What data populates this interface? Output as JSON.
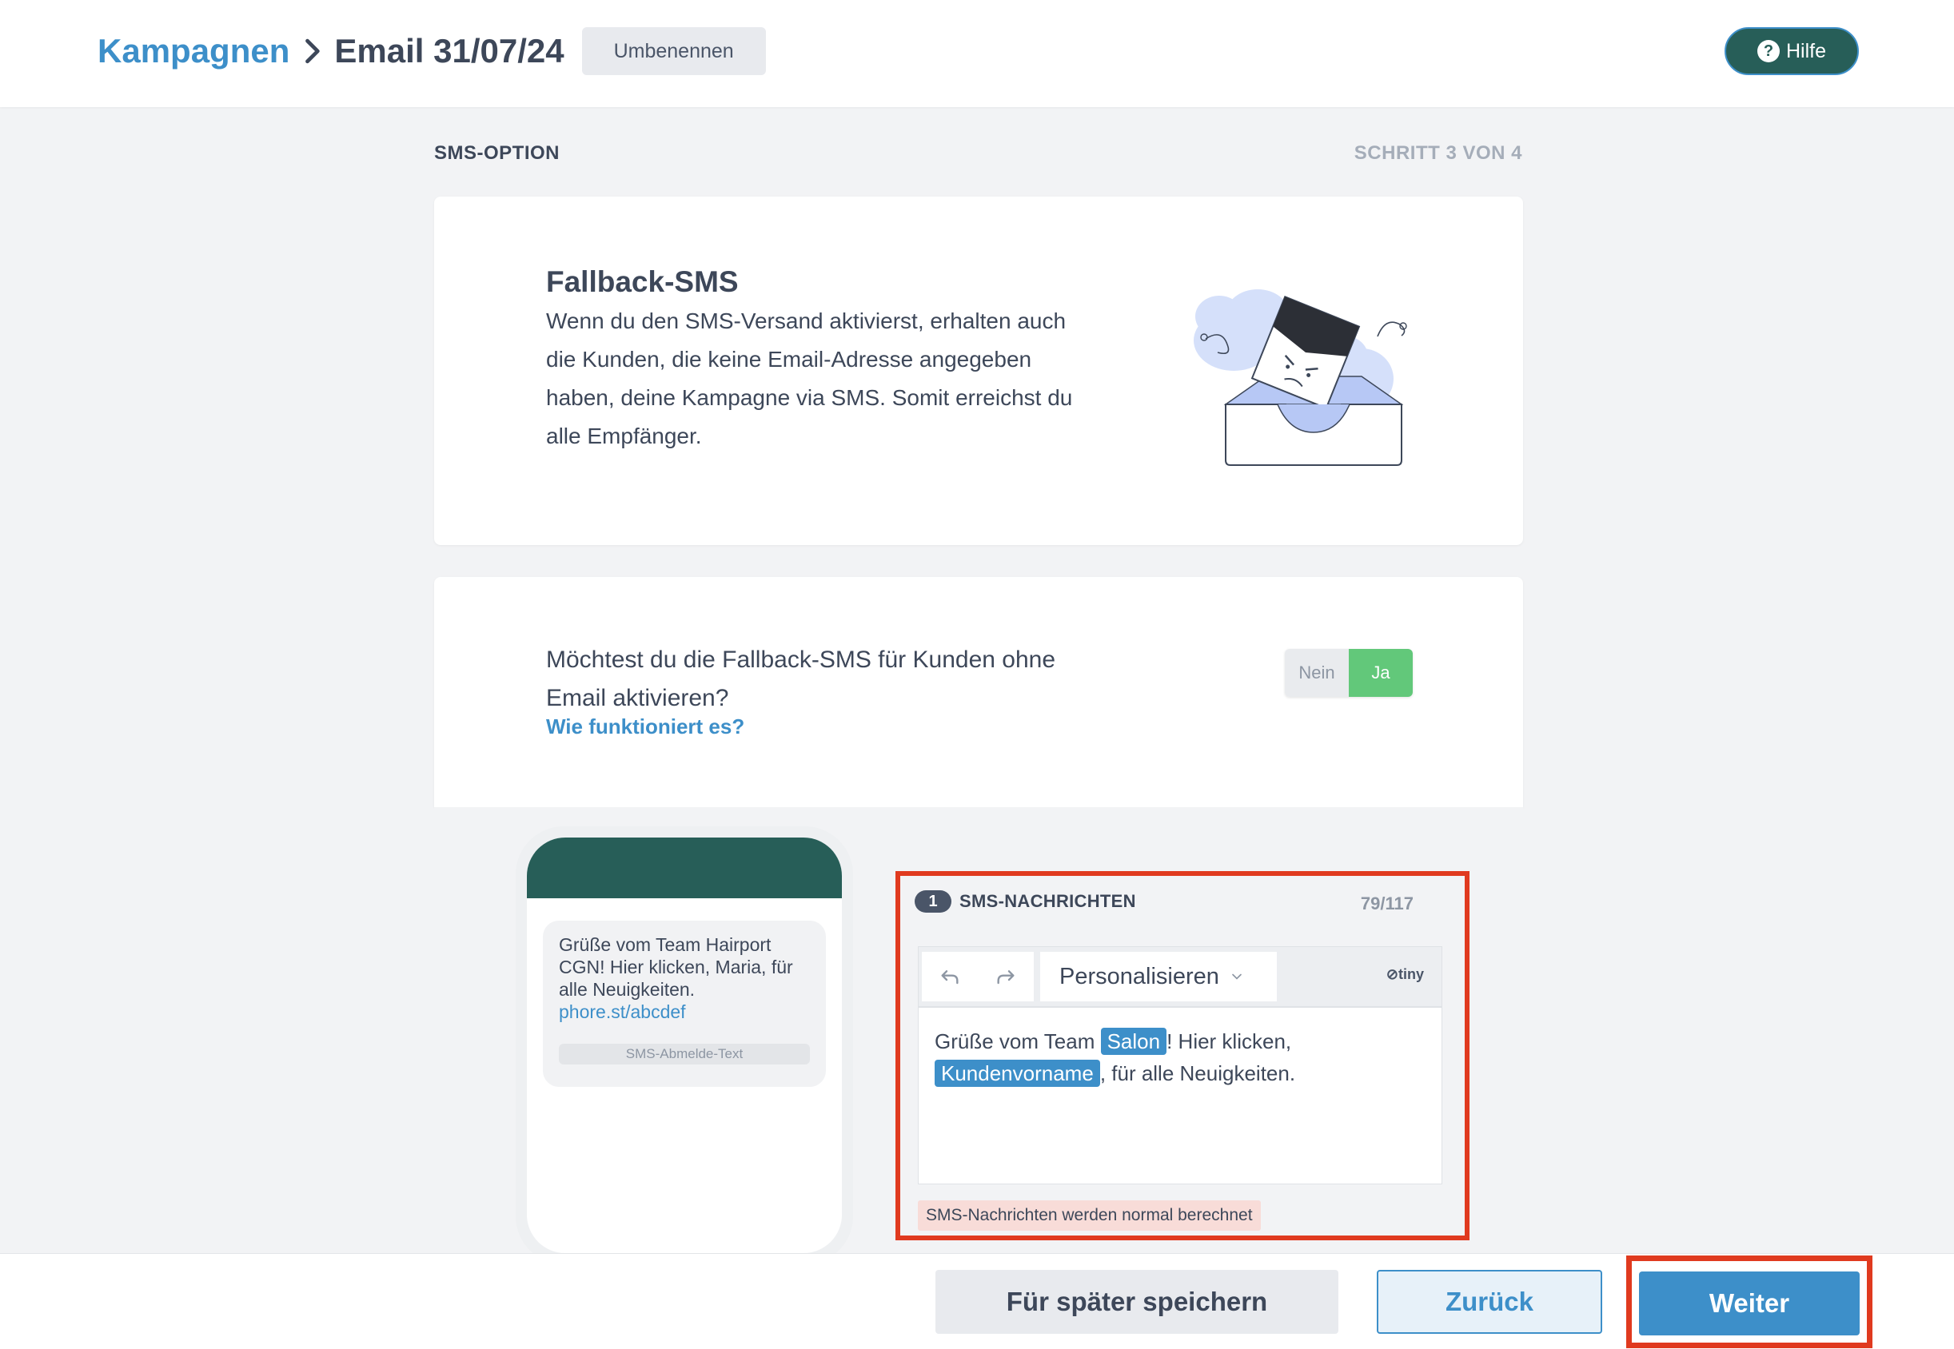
{
  "header": {
    "breadcrumb_root": "Kampagnen",
    "campaign_name": "Email 31/07/24",
    "rename_label": "Umbenennen",
    "help_label": "Hilfe"
  },
  "step": {
    "title": "SMS-OPTION",
    "count": "SCHRITT 3 VON 4"
  },
  "info": {
    "title": "Fallback-SMS",
    "text": "Wenn du den SMS-Versand aktivierst, erhalten auch die Kunden, die keine Email-Adresse angegeben haben, deine Kampagne via SMS. Somit erreichst du alle Empfänger."
  },
  "option": {
    "question": "Möchtest du die Fallback-SMS für Kunden ohne Email aktivieren?",
    "link": "Wie funktioniert es?",
    "toggle_no": "Nein",
    "toggle_yes": "Ja",
    "selected": "Ja"
  },
  "phone_preview": {
    "message": "Grüße vom Team Hairport CGN! Hier klicken, Maria, für alle Neuigkeiten.",
    "link": "phore.st/abcdef",
    "unsubscribe": "SMS-Abmelde-Text"
  },
  "editor": {
    "number": "1",
    "label": "SMS-NACHRICHTEN",
    "char_count": "79/117",
    "personalize_label": "Personalisieren",
    "tiny_label": "tiny",
    "content": {
      "part1": "Grüße vom Team ",
      "tag1": "Salon",
      "part2": "! Hier klicken, ",
      "tag2": "Kundenvorname",
      "part3": ", für alle Neuigkeiten."
    },
    "note": "SMS-Nachrichten werden normal berechnet"
  },
  "footer": {
    "save_label": "Für später speichern",
    "back_label": "Zurück",
    "next_label": "Weiter"
  },
  "colors": {
    "accent": "#3d8fc9",
    "dark_green": "#275e58",
    "toggle_on": "#62c87a",
    "highlight": "#e03a1f"
  }
}
